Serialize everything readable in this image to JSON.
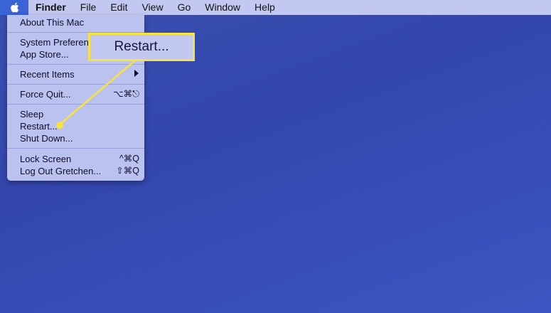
{
  "menubar": {
    "apple_icon": "apple-logo-icon",
    "items": [
      "Finder",
      "File",
      "Edit",
      "View",
      "Go",
      "Window",
      "Help"
    ]
  },
  "apple_menu": {
    "about": "About This Mac",
    "system_prefs": "System Preferen",
    "app_store": "App Store...",
    "recent_items": "Recent Items",
    "force_quit": "Force Quit...",
    "force_quit_shortcut": "⌥⌘⎋",
    "sleep": "Sleep",
    "restart": "Restart...",
    "shut_down": "Shut Down...",
    "lock_screen": "Lock Screen",
    "lock_shortcut": "^⌘Q",
    "log_out": "Log Out Gretchen...",
    "log_out_shortcut": "⇧⌘Q"
  },
  "callout": {
    "label": "Restart...",
    "color": "#f7e23e"
  },
  "colors": {
    "desktop": "#3446ad",
    "menu_bg": "#bcc2ef",
    "apple_highlight": "#3b63d8"
  }
}
